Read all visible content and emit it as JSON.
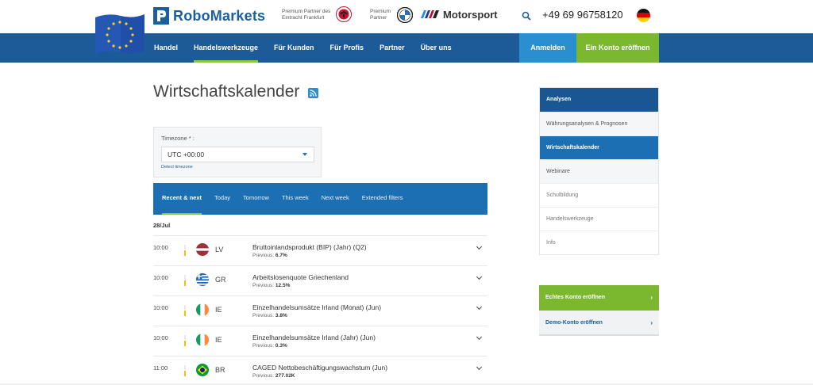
{
  "header": {
    "logo_text": "RoboMarkets",
    "partner1_text": "Premium Partner des Eintracht Frankfurt",
    "partner2_text": "Premium Partner",
    "motorsport_text": "Motorsport",
    "phone": "+49 69 96758120"
  },
  "nav": {
    "items": [
      "Handel",
      "Handelswerkzeuge",
      "Für Kunden",
      "Für Profis",
      "Partner",
      "Über uns"
    ],
    "active": "Handelswerkzeuge",
    "login_label": "Anmelden",
    "open_account_label": "Ein Konto eröffnen"
  },
  "page": {
    "title": "Wirtschaftskalender"
  },
  "timezone": {
    "label": "Timezone * :",
    "value": "UTC +00:00",
    "detect_link": "Detect timezone"
  },
  "tabs": [
    "Recent & next",
    "Today",
    "Tomorrow",
    "This week",
    "Next week",
    "Extended filters"
  ],
  "calendar": {
    "date": "28/Jul",
    "previous_label": "Previous:",
    "events": [
      {
        "time": "10:00",
        "country": "LV",
        "name": "Bruttoinlandsprodukt (BIP) (Jahr) (Q2)",
        "previous": "6.7%"
      },
      {
        "time": "10:00",
        "country": "GR",
        "name": "Arbeitslosenquote Griechenland",
        "previous": "12.5%"
      },
      {
        "time": "10:00",
        "country": "IE",
        "name": "Einzelhandelsumsätze Irland (Monat) (Jun)",
        "previous": "3.8%"
      },
      {
        "time": "10:00",
        "country": "IE",
        "name": "Einzelhandelsumsätze Irland (Jahr) (Jun)",
        "previous": "0.3%"
      },
      {
        "time": "11:00",
        "country": "BR",
        "name": "CAGED Nettobeschäftigungswachstum (Jun)",
        "previous": "277.02K"
      }
    ]
  },
  "sidebar": {
    "items": [
      "Analysen",
      "Währungsanalysen & Prognosen",
      "Wirtschaftskalender",
      "Webinare",
      "Schulbildung",
      "Handelswerkzeuge",
      "Info"
    ],
    "active": "Wirtschaftskalender"
  },
  "cta": {
    "real_label": "Echtes Konto eröffnen",
    "demo_label": "Demo-Konto eröffnen",
    "arrow": "›"
  },
  "colors": {
    "brand_blue": "#1d5b98",
    "accent_green": "#7cb82f",
    "login_blue": "#2a8fd0"
  }
}
